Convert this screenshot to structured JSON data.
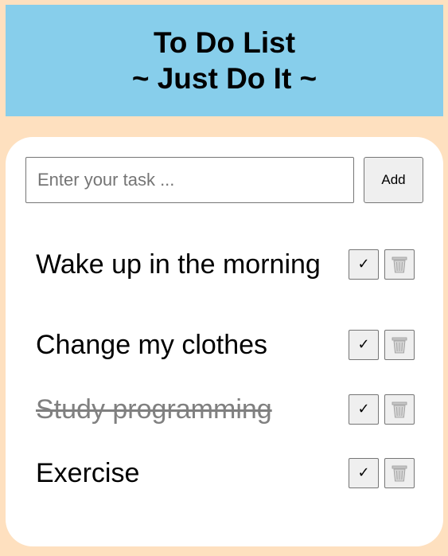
{
  "header": {
    "title_line1": "To Do List",
    "title_line2": "~ Just Do It ~"
  },
  "input": {
    "placeholder": "Enter your task ...",
    "value": ""
  },
  "add_button_label": "Add",
  "tasks": [
    {
      "text": "Wake up in the morning",
      "completed": false
    },
    {
      "text": "Change my clothes",
      "completed": false
    },
    {
      "text": "Study programming",
      "completed": true
    },
    {
      "text": "Exercise",
      "completed": false
    }
  ],
  "icons": {
    "complete": "check-icon",
    "delete": "trash-icon"
  },
  "colors": {
    "page_background": "#fee0bf",
    "header_background": "#87ceeb",
    "card_background": "#ffffff",
    "completed_text": "#808080"
  }
}
